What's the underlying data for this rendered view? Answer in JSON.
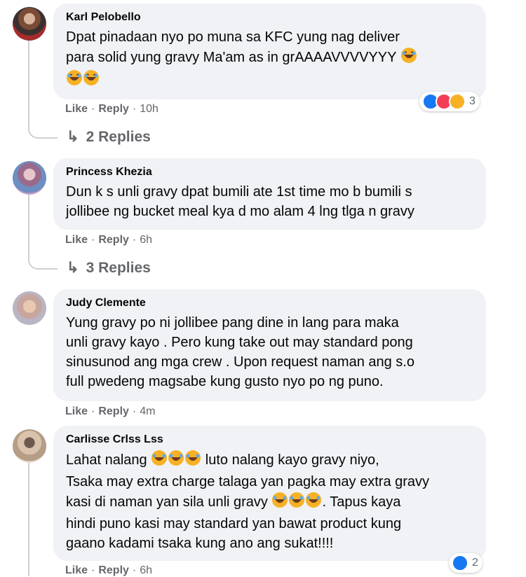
{
  "comments": [
    {
      "author": "Karl Pelobello",
      "text": "Dpat pinadaan nyo po muna sa KFC yung nag deliver\npara solid yung gravy Ma'am as in grAAAAVVVVYYY",
      "like": "Like",
      "reply": "Reply",
      "time": "10h",
      "reaction_count": "3",
      "reactions": [
        "like-icon",
        "love-icon",
        "haha-icon"
      ],
      "replies": "2 Replies"
    },
    {
      "author": "Princess Khezia",
      "text": "Dun k s unli gravy dpat bumili ate 1st time mo b bumili s\njollibee ng bucket meal kya d mo alam 4 lng tlga n gravy",
      "like": "Like",
      "reply": "Reply",
      "time": "6h",
      "replies": "3 Replies"
    },
    {
      "author": "Judy Clemente",
      "text": "Yung gravy po ni jollibee pang dine in lang para maka\nunli gravy kayo . Pero kung take out may standard pong\nsinusunod ang mga crew . Upon request naman ang s.o\nfull pwedeng magsabe kung gusto nyo po ng puno.",
      "like": "Like",
      "reply": "Reply",
      "time": "4m"
    },
    {
      "author": "Carlisse Crlss Lss",
      "text_a": "Lahat nalang",
      "text_b": "luto nalang kayo gravy niyo,",
      "text_c": "Tsaka may extra charge talaga yan pagka may extra gravy",
      "text_d": "kasi di naman yan sila unli gravy",
      "text_e": ". Tapus kaya",
      "text_f": "hindi puno kasi may standard yan bawat product kung",
      "text_g": "gaano kadami tsaka kung ano ang sukat!!!!",
      "like": "Like",
      "reply": "Reply",
      "time": "6h",
      "reaction_count": "2",
      "reactions": [
        "like-icon"
      ]
    }
  ],
  "dot": "·",
  "colors": {
    "like": "#1877f2",
    "love": "#f33e58",
    "haha": "#f7b125",
    "bubble": "#f0f2f5",
    "meta": "#65676b"
  }
}
